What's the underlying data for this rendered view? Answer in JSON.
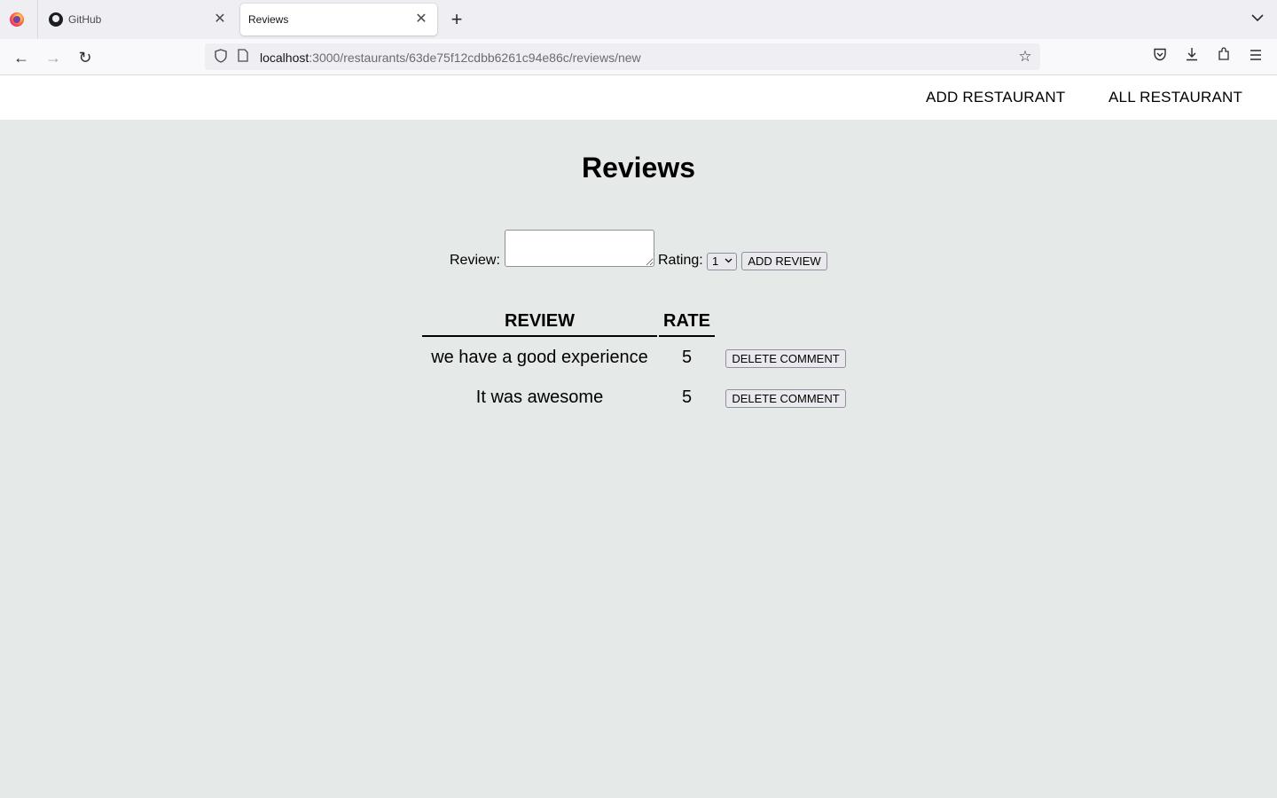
{
  "browser": {
    "tabs": [
      {
        "title": "GitHub",
        "active": false
      },
      {
        "title": "Reviews",
        "active": true
      }
    ],
    "url": {
      "host": "localhost",
      "rest": ":3000/restaurants/63de75f12cdbb6261c94e86c/reviews/new"
    },
    "icons": [
      "firefox-logo-icon",
      "github-icon",
      "close-icon",
      "plus-icon",
      "chevron-down-icon",
      "back-icon",
      "forward-icon",
      "reload-icon",
      "shield-icon",
      "page-icon",
      "bookmark-star-icon",
      "pocket-icon",
      "download-icon",
      "extensions-icon",
      "menu-icon"
    ]
  },
  "header": {
    "add_restaurant": "ADD RESTAURANT",
    "all_restaurant": "ALL RESTAURANT"
  },
  "page": {
    "title": "Reviews"
  },
  "form": {
    "review_label": "Review:",
    "review_value": "",
    "rating_label": "Rating:",
    "rating_selected": "1",
    "submit_label": "ADD REVIEW"
  },
  "table": {
    "headers": [
      "REVIEW",
      "RATE"
    ],
    "rows": [
      {
        "review": "we have a good experience",
        "rate": "5",
        "action": "DELETE COMMENT"
      },
      {
        "review": "It was awesome",
        "rate": "5",
        "action": "DELETE COMMENT"
      }
    ]
  }
}
